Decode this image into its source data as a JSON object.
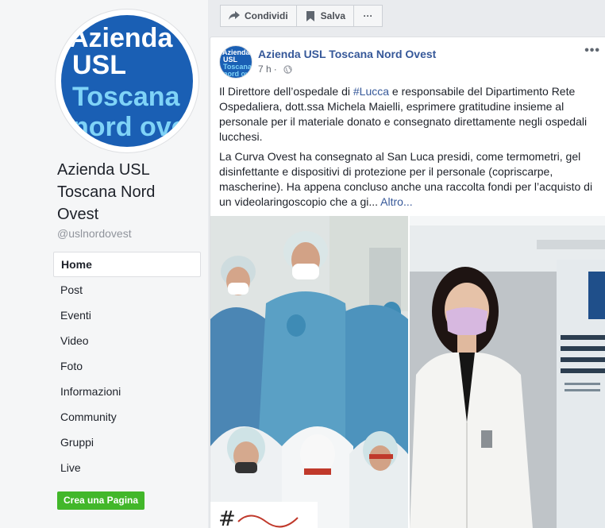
{
  "sidebar": {
    "logo_lines": [
      "Azienda",
      "USL",
      "Toscana",
      "nord ovest"
    ],
    "page_name": "Azienda USL Toscana Nord Ovest",
    "handle": "@uslnordovest",
    "nav_items": [
      {
        "label": "Home",
        "active": true
      },
      {
        "label": "Post"
      },
      {
        "label": "Eventi"
      },
      {
        "label": "Video"
      },
      {
        "label": "Foto"
      },
      {
        "label": "Informazioni"
      },
      {
        "label": "Community"
      },
      {
        "label": "Gruppi"
      },
      {
        "label": "Live"
      }
    ],
    "create_page_label": "Crea una Pagina"
  },
  "actionbar": {
    "share_label": "Condividi",
    "save_label": "Salva",
    "more_label": "···"
  },
  "post": {
    "author": "Azienda USL Toscana Nord Ovest",
    "time": "7 h",
    "menu_label": "•••",
    "p1_before": "Il Direttore dell’ospedale di ",
    "p1_hashtag": "#Lucca",
    "p1_after": " e responsabile del Dipartimento Rete Ospedaliera, dott.ssa Michela Maielli, esprimere gratitudine insieme al personale per il materiale donato e consegnato direttamente negli ospedali lucchesi.",
    "p2": "La Curva Ovest ha consegnato al San Luca presidi, come termometri, gel disinfettante e dispositivi di protezione per il personale (copriscarpe, mascherine). Ha appena concluso anche una raccolta fondi per l’acquisto di un videolaringoscopio che a gi...",
    "more_link": "Altro..."
  },
  "colors": {
    "brand_blue": "#1a5fb4",
    "link_blue": "#365899",
    "green_button": "#42b72a",
    "logo_cyan": "#7fd3f7"
  }
}
